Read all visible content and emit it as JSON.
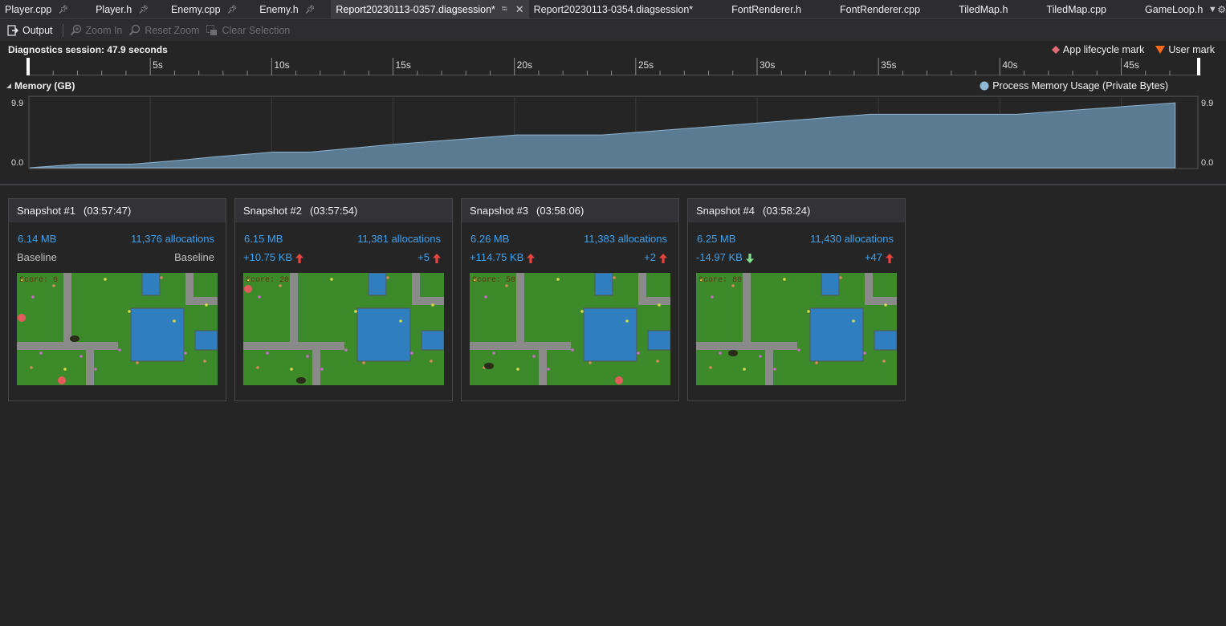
{
  "tabs": [
    {
      "label": "Player.cpp",
      "pinned": true
    },
    {
      "label": "Player.h",
      "pinned": true
    },
    {
      "label": "Enemy.cpp",
      "pinned": true
    },
    {
      "label": "Enemy.h",
      "pinned": true
    },
    {
      "label": "Report20230113-0357.diagsession*",
      "active": true
    },
    {
      "label": "Report20230113-0354.diagsession*"
    },
    {
      "label": "FontRenderer.h"
    },
    {
      "label": "FontRenderer.cpp"
    },
    {
      "label": "TiledMap.h"
    },
    {
      "label": "TiledMap.cpp"
    },
    {
      "label": "GameLoop.h"
    }
  ],
  "toolbar": {
    "output": "Output",
    "zoom_in": "Zoom In",
    "reset_zoom": "Reset Zoom",
    "clear_selection": "Clear Selection"
  },
  "session": {
    "title": "Diagnostics session: 47.9 seconds",
    "legend_lifecycle": "App lifecycle mark",
    "legend_user": "User mark",
    "lifecycle_color": "#e06c75",
    "user_color": "#ff6a1a"
  },
  "ruler": {
    "ticks": [
      "5s",
      "10s",
      "15s",
      "20s",
      "25s",
      "30s",
      "35s",
      "40s",
      "45s"
    ]
  },
  "memory": {
    "title": "Memory (GB)",
    "legend": "Process Memory Usage (Private Bytes)",
    "y_max_label": "9.9",
    "y_min_label": "0.0",
    "fill_color": "#5b7b92"
  },
  "chart_data": {
    "type": "area",
    "title": "Memory (GB)",
    "series": [
      {
        "name": "Process Memory Usage (Private Bytes)",
        "x": [
          0,
          0.8,
          2,
          4.2,
          6,
          7.5,
          10,
          11.5,
          15,
          20,
          23.5,
          30,
          34.5,
          37,
          40.5,
          47
        ],
        "values": [
          0,
          0.2,
          0.5,
          0.5,
          1.0,
          1.5,
          2.2,
          2.2,
          3.3,
          4.6,
          4.6,
          6.3,
          7.5,
          7.5,
          7.5,
          9.1
        ]
      }
    ],
    "xlim": [
      0,
      47.9
    ],
    "ylim": [
      0,
      9.9
    ],
    "grid": true
  },
  "snapshots": [
    {
      "title": "Snapshot #1",
      "time": "(03:57:47)",
      "size": "6.14 MB",
      "allocs": "11,376 allocations",
      "size_delta": "Baseline",
      "alloc_delta": "Baseline",
      "size_dir": "none",
      "alloc_dir": "none",
      "score": "Score: 0"
    },
    {
      "title": "Snapshot #2",
      "time": "(03:57:54)",
      "size": "6.15 MB",
      "allocs": "11,381 allocations",
      "size_delta": "+10.75 KB",
      "alloc_delta": "+5",
      "size_dir": "up",
      "alloc_dir": "up",
      "score": "Score: 20"
    },
    {
      "title": "Snapshot #3",
      "time": "(03:58:06)",
      "size": "6.26 MB",
      "allocs": "11,383 allocations",
      "size_delta": "+114.75 KB",
      "alloc_delta": "+2",
      "size_dir": "up",
      "alloc_dir": "up",
      "score": "Score: 50"
    },
    {
      "title": "Snapshot #4",
      "time": "(03:58:24)",
      "size": "6.25 MB",
      "allocs": "11,430 allocations",
      "size_delta": "-14.97 KB",
      "alloc_delta": "+47",
      "size_dir": "down",
      "alloc_dir": "up",
      "score": "Score: 80"
    }
  ]
}
